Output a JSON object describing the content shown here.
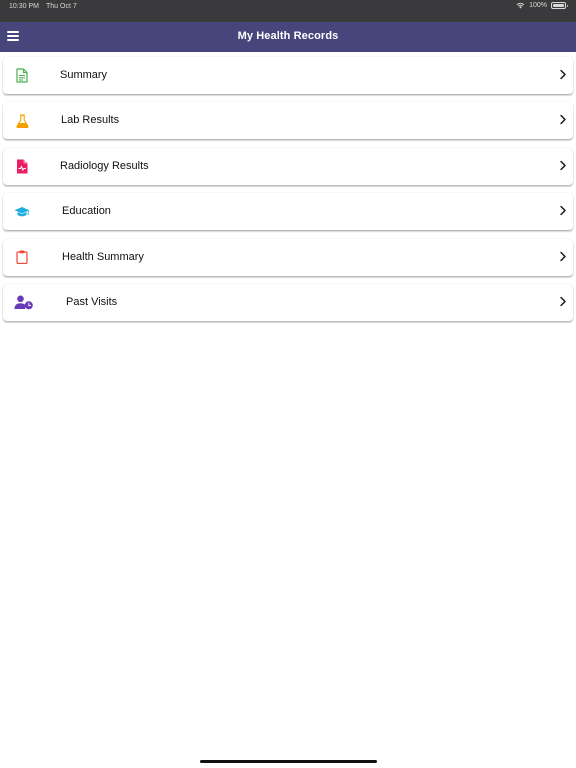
{
  "status_bar": {
    "time": "10:30 PM",
    "date": "Thu Oct 7",
    "battery": "100%",
    "battery_level": 1.0
  },
  "header": {
    "title": "My Health Records",
    "menu_icon": "hamburger-menu-icon",
    "background": "#46467c"
  },
  "menu": {
    "items": [
      {
        "label": "Summary",
        "icon": "document-icon",
        "color": "#4caf50"
      },
      {
        "label": "Lab Results",
        "icon": "flask-icon",
        "color": "#f5a000"
      },
      {
        "label": "Radiology Results",
        "icon": "medical-file-icon",
        "color": "#e91e63"
      },
      {
        "label": "Education",
        "icon": "graduation-cap-icon",
        "color": "#1eaee0"
      },
      {
        "label": "Health Summary",
        "icon": "clipboard-icon",
        "color": "#f44336"
      },
      {
        "label": "Past Visits",
        "icon": "user-clock-icon",
        "color": "#673ab7"
      }
    ]
  }
}
